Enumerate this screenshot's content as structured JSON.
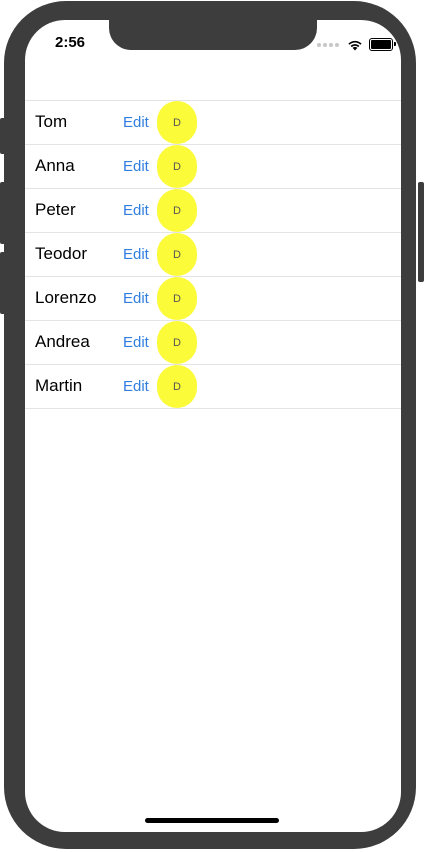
{
  "status_bar": {
    "time": "2:56"
  },
  "people": [
    {
      "name": "Tom",
      "edit_label": "Edit",
      "badge_label": "D"
    },
    {
      "name": "Anna",
      "edit_label": "Edit",
      "badge_label": "D"
    },
    {
      "name": "Peter",
      "edit_label": "Edit",
      "badge_label": "D"
    },
    {
      "name": "Teodor",
      "edit_label": "Edit",
      "badge_label": "D"
    },
    {
      "name": "Lorenzo",
      "edit_label": "Edit",
      "badge_label": "D"
    },
    {
      "name": "Andrea",
      "edit_label": "Edit",
      "badge_label": "D"
    },
    {
      "name": "Martin",
      "edit_label": "Edit",
      "badge_label": "D"
    }
  ],
  "colors": {
    "accent": "#2f7ee0",
    "badge": "#fbfb3a",
    "frame": "#3d3d3d"
  },
  "icons": [
    "wifi-icon",
    "battery-icon",
    "signal-icon"
  ]
}
